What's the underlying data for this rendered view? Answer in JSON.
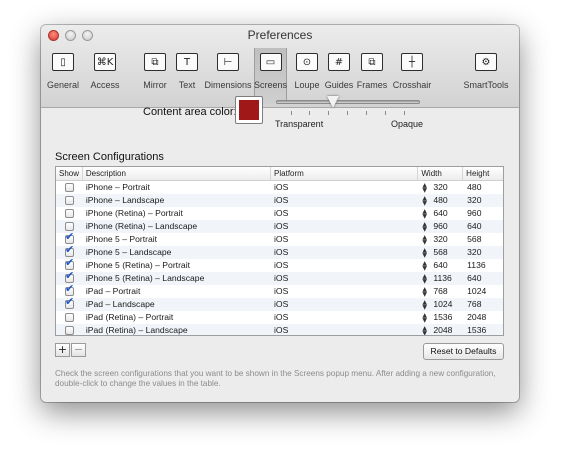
{
  "window": {
    "title": "Preferences"
  },
  "toolbar": {
    "items": [
      {
        "label": "General",
        "glyph": "▯",
        "icon": "general-icon"
      },
      {
        "label": "Access",
        "glyph": "⌘K",
        "icon": "keyboard-icon"
      },
      {
        "label": "Mirror",
        "glyph": "⧉",
        "icon": "mirror-icon"
      },
      {
        "label": "Text",
        "glyph": "T",
        "icon": "text-icon"
      },
      {
        "label": "Dimensions",
        "glyph": "⊢",
        "icon": "dimensions-icon"
      },
      {
        "label": "Screens",
        "glyph": "▭",
        "icon": "screens-icon"
      },
      {
        "label": "Loupe",
        "glyph": "⊙",
        "icon": "loupe-icon"
      },
      {
        "label": "Guides",
        "glyph": "#",
        "icon": "guides-icon"
      },
      {
        "label": "Frames",
        "glyph": "⧉",
        "icon": "frames-icon"
      },
      {
        "label": "Crosshair",
        "glyph": "┼",
        "icon": "crosshair-icon"
      },
      {
        "label": "SmartTools",
        "glyph": "⚙",
        "icon": "gear-icon"
      }
    ],
    "selected": "Screens"
  },
  "content_color": {
    "label": "Content area color:",
    "swatch_color": "#a01818",
    "slider_left": "Transparent",
    "slider_right": "Opaque"
  },
  "screen_configs": {
    "title": "Screen Configurations",
    "columns": [
      "Show",
      "Description",
      "Platform",
      "Width",
      "Height"
    ],
    "rows": [
      {
        "show": false,
        "description": "iPhone – Portrait",
        "platform": "iOS",
        "width": "320",
        "height": "480"
      },
      {
        "show": false,
        "description": "iPhone – Landscape",
        "platform": "iOS",
        "width": "480",
        "height": "320"
      },
      {
        "show": false,
        "description": "iPhone (Retina) – Portrait",
        "platform": "iOS",
        "width": "640",
        "height": "960"
      },
      {
        "show": false,
        "description": "iPhone (Retina) – Landscape",
        "platform": "iOS",
        "width": "960",
        "height": "640"
      },
      {
        "show": true,
        "description": "iPhone 5 – Portrait",
        "platform": "iOS",
        "width": "320",
        "height": "568"
      },
      {
        "show": true,
        "description": "iPhone 5 – Landscape",
        "platform": "iOS",
        "width": "568",
        "height": "320"
      },
      {
        "show": true,
        "description": "iPhone 5 (Retina) – Portrait",
        "platform": "iOS",
        "width": "640",
        "height": "1136"
      },
      {
        "show": true,
        "description": "iPhone 5 (Retina) – Landscape",
        "platform": "iOS",
        "width": "1136",
        "height": "640"
      },
      {
        "show": true,
        "description": "iPad – Portrait",
        "platform": "iOS",
        "width": "768",
        "height": "1024"
      },
      {
        "show": true,
        "description": "iPad – Landscape",
        "platform": "iOS",
        "width": "1024",
        "height": "768"
      },
      {
        "show": false,
        "description": "iPad (Retina) – Portrait",
        "platform": "iOS",
        "width": "1536",
        "height": "2048"
      },
      {
        "show": false,
        "description": "iPad (Retina) – Landscape",
        "platform": "iOS",
        "width": "2048",
        "height": "1536"
      }
    ]
  },
  "buttons": {
    "add": "+",
    "remove": "−",
    "reset": "Reset to Defaults"
  },
  "help_text": "Check the screen configurations that you want to be shown in the Screens popup menu. After adding a new configuration, double-click to change the values in the table."
}
